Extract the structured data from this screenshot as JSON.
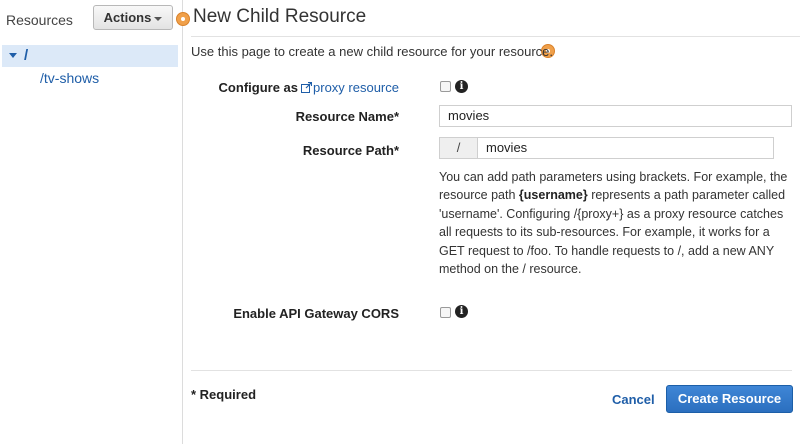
{
  "sidebar": {
    "title": "Resources",
    "actions_label": "Actions",
    "tree": {
      "root_label": "/",
      "children": [
        "/tv-shows"
      ]
    }
  },
  "main": {
    "title": "New Child Resource",
    "intro": "Use this page to create a new child resource for your resource.",
    "form": {
      "proxy_prefix": "Configure as",
      "proxy_link": "proxy resource",
      "proxy_checked": false,
      "resource_name_label": "Resource Name*",
      "resource_name_value": "movies",
      "resource_path_label": "Resource Path*",
      "resource_path_prefix": "/",
      "resource_path_value": "movies",
      "help_part1": "You can add path parameters using brackets. For example, the resource path ",
      "help_bold": "{username}",
      "help_part2": " represents a path parameter called 'username'. Configuring /{proxy+} as a proxy resource catches all requests to its sub-resources. For example, it works for a GET request to /foo. To handle requests to /, add a new ANY method on the / resource.",
      "cors_label": "Enable API Gateway CORS",
      "cors_checked": false
    },
    "footer": {
      "required_note": "* Required",
      "cancel_label": "Cancel",
      "create_label": "Create Resource"
    }
  },
  "icons": {
    "info": "info-icon",
    "external_link": "external-link-icon",
    "marker": "marker-icon"
  },
  "colors": {
    "link": "#1f5ea8",
    "primary_button": "#2f74c6",
    "selected_row": "#dce9f8",
    "marker": "#f0a04a"
  }
}
